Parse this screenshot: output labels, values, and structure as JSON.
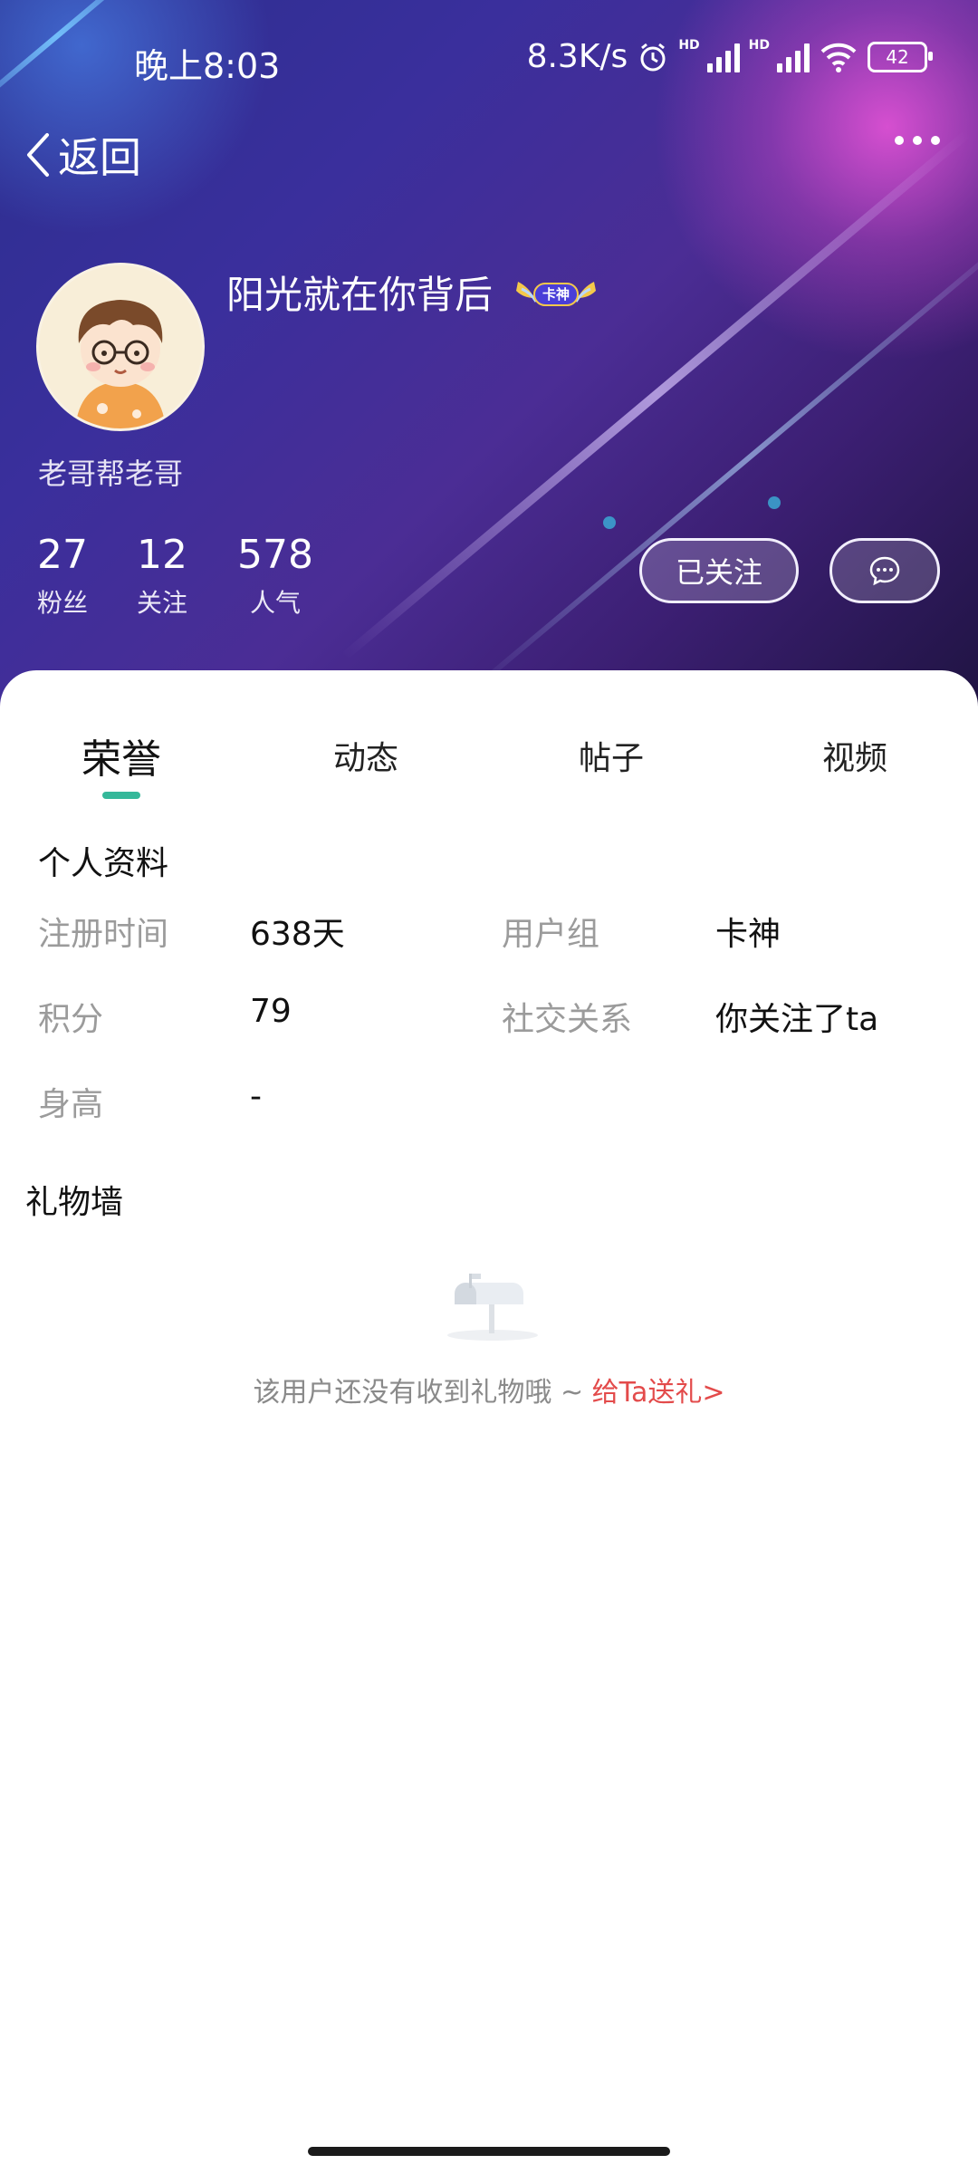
{
  "status_bar": {
    "time": "晚上8:03",
    "net_speed": "8.3K/s",
    "signal_badge": "HD",
    "battery": "42"
  },
  "nav": {
    "back_label": "返回"
  },
  "profile": {
    "nickname": "阳光就在你背后",
    "badge_text": "卡神",
    "signature": "老哥帮老哥",
    "stats": [
      {
        "value": "27",
        "label": "粉丝"
      },
      {
        "value": "12",
        "label": "关注"
      },
      {
        "value": "578",
        "label": "人气"
      }
    ],
    "follow_label": "已关注"
  },
  "tabs": [
    {
      "label": "荣誉",
      "active": true
    },
    {
      "label": "动态",
      "active": false
    },
    {
      "label": "帖子",
      "active": false
    },
    {
      "label": "视频",
      "active": false
    }
  ],
  "info": {
    "title": "个人资料",
    "register_label": "注册时间",
    "register_value": "638天",
    "group_label": "用户组",
    "group_value": "卡神",
    "points_label": "积分",
    "points_value": "79",
    "relation_label": "社交关系",
    "relation_value": "你关注了ta",
    "height_label": "身高",
    "height_value": "-"
  },
  "gift_wall": {
    "title": "礼物墙",
    "empty_text": "该用户还没有收到礼物哦 ~ ",
    "send_link": "给Ta送礼>"
  },
  "colors": {
    "accent": "#35b89a",
    "link_red": "#e34b4b"
  }
}
